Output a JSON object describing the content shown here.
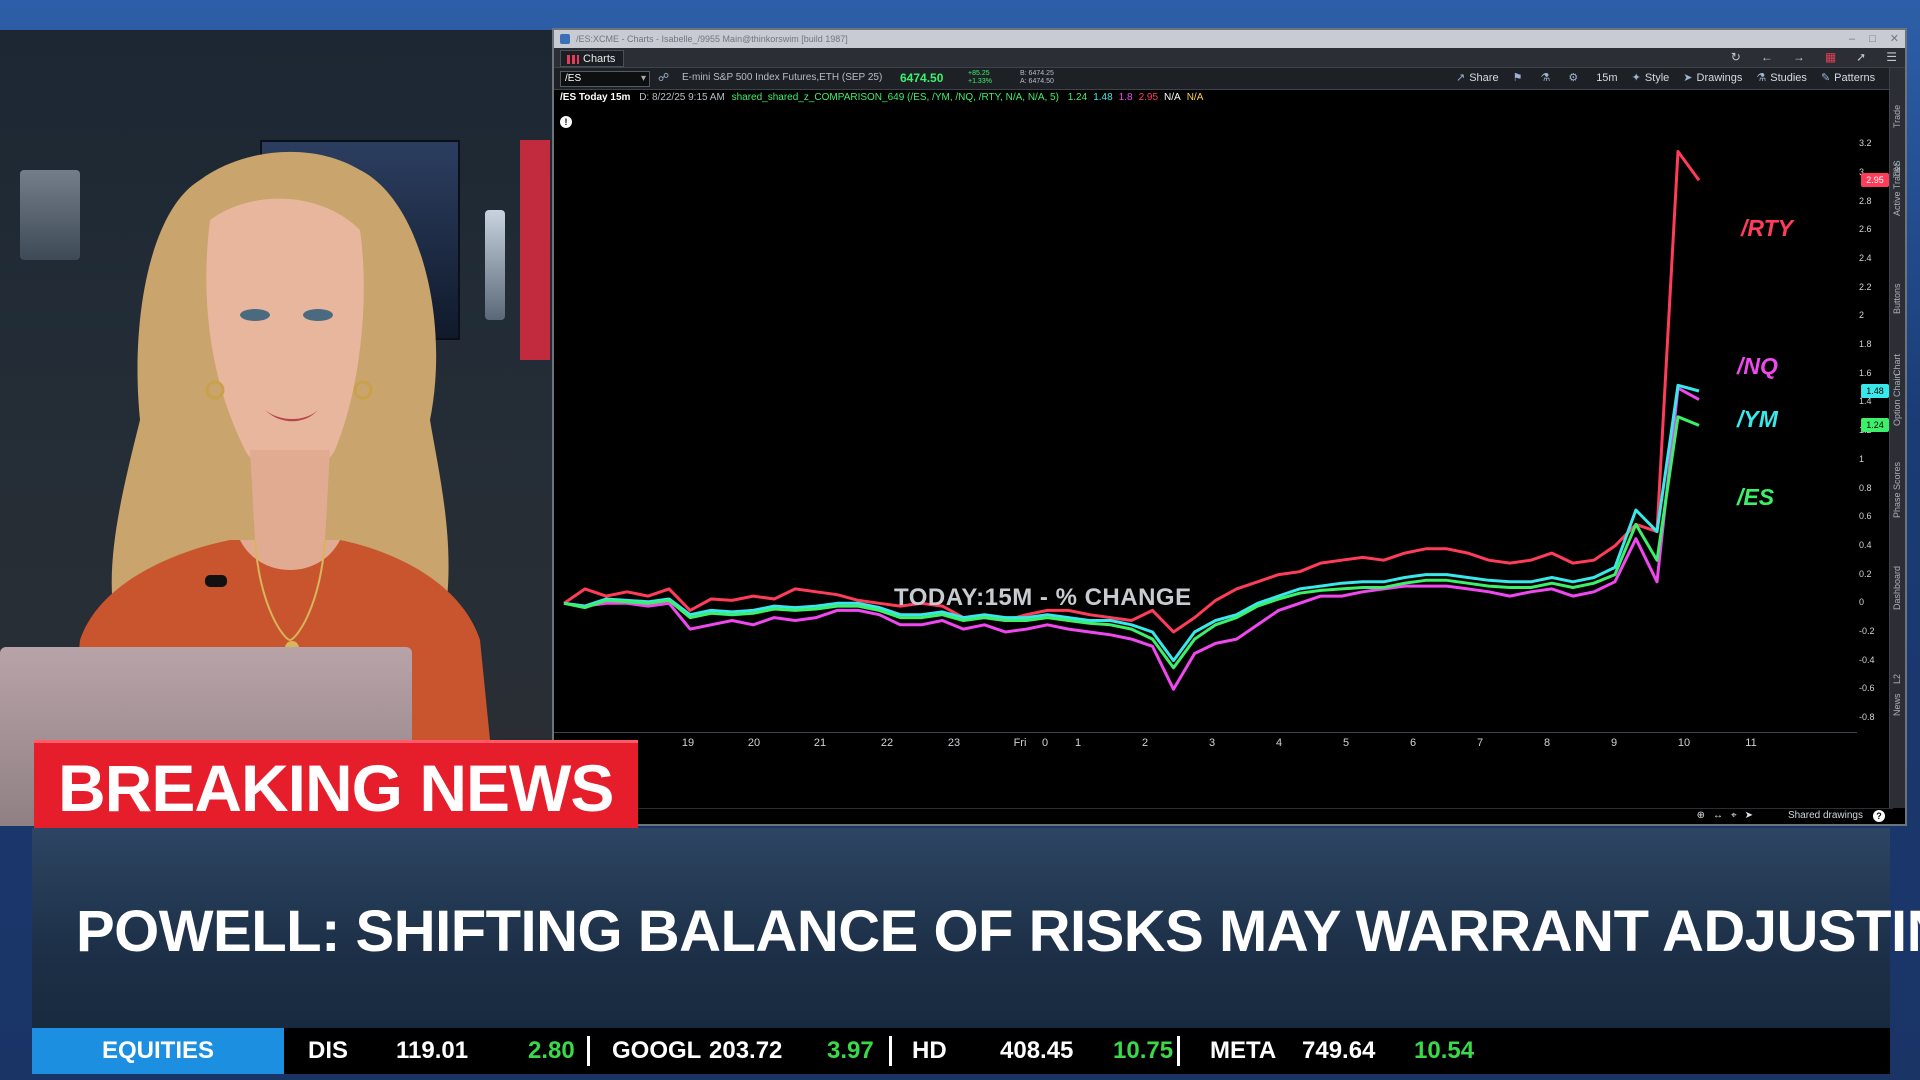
{
  "window": {
    "title": "/ES:XCME - Charts - Isabelle_/9955 Main@thinkorswim [build 1987]",
    "tab_label": "Charts"
  },
  "toolbar": {
    "symbol": "/ES",
    "description": "E-mini S&P 500 Index Futures,ETH (SEP 25)",
    "last_price": "6474.50",
    "net_change": "+85.25",
    "pct_change": "+1.33%",
    "bid": "B: 6474.25",
    "ask": "A: 6474.50",
    "buttons": [
      "Share",
      "15m",
      "Style",
      "Drawings",
      "Studies",
      "Patterns"
    ]
  },
  "study_bar": {
    "symbol_tf": "/ES Today 15m",
    "timestamp": "D: 8/22/25 9:15 AM",
    "study": "shared_shared_z_COMPARISON_649 (/ES, /YM, /NQ, /RTY, N/A, N/A, 5)",
    "values": [
      {
        "text": "1.24",
        "color": "#3df06a"
      },
      {
        "text": "1.48",
        "color": "#38e8ea"
      },
      {
        "text": "1.8",
        "color": "#ee48ee"
      },
      {
        "text": "2.95",
        "color": "#ff3c5a"
      },
      {
        "text": "N/A",
        "color": "#ffffff"
      },
      {
        "text": "N/A",
        "color": "#ffd23c"
      }
    ]
  },
  "side_tabs": [
    "Trade",
    "T&S",
    "Active Trader",
    "Buttons",
    "Chart",
    "Option Chain",
    "Phase Scores",
    "Dashboard",
    "L2",
    "News"
  ],
  "bottom_bar": {
    "shared_drawings": "Shared drawings"
  },
  "chart_data": {
    "type": "line",
    "caption": "TODAY:15M - % CHANGE",
    "x_tick_labels": [
      "19",
      "20",
      "21",
      "22",
      "23",
      "Fri",
      "0",
      "1",
      "2",
      "3",
      "4",
      "5",
      "6",
      "7",
      "8",
      "9",
      "10",
      "11"
    ],
    "y_tick_labels": [
      "3.2",
      "3",
      "2.8",
      "2.6",
      "2.4",
      "2.2",
      "2",
      "1.8",
      "1.6",
      "1.4",
      "1.2",
      "1",
      "0.8",
      "0.6",
      "0.4",
      "0.2",
      "0",
      "-0.2",
      "-0.4",
      "-0.6",
      "-0.8"
    ],
    "ylim": [
      -0.8,
      3.3
    ],
    "series": [
      {
        "name": "/RTY",
        "color": "#ff3c5a",
        "badge": "2.95",
        "values": [
          0,
          0.1,
          0.05,
          0.08,
          0.05,
          0.1,
          -0.05,
          0.03,
          0.02,
          0.05,
          0.03,
          0.1,
          0.08,
          0.06,
          0.02,
          0,
          -0.02,
          0,
          -0.02,
          -0.1,
          -0.1,
          -0.12,
          -0.08,
          -0.05,
          -0.05,
          -0.08,
          -0.1,
          -0.12,
          -0.05,
          -0.2,
          -0.1,
          0.02,
          0.1,
          0.15,
          0.2,
          0.22,
          0.28,
          0.3,
          0.32,
          0.3,
          0.35,
          0.38,
          0.38,
          0.35,
          0.3,
          0.28,
          0.3,
          0.35,
          0.28,
          0.3,
          0.4,
          0.55,
          0.5,
          3.15,
          2.95
        ]
      },
      {
        "name": "/NQ",
        "color": "#ee48ee",
        "badge": "1.8",
        "values": [
          0,
          -0.02,
          0,
          0,
          -0.02,
          0,
          -0.18,
          -0.15,
          -0.12,
          -0.15,
          -0.1,
          -0.12,
          -0.1,
          -0.05,
          -0.05,
          -0.08,
          -0.15,
          -0.15,
          -0.12,
          -0.18,
          -0.15,
          -0.2,
          -0.18,
          -0.15,
          -0.18,
          -0.2,
          -0.22,
          -0.25,
          -0.3,
          -0.6,
          -0.35,
          -0.28,
          -0.25,
          -0.15,
          -0.05,
          0,
          0.05,
          0.05,
          0.08,
          0.1,
          0.12,
          0.12,
          0.12,
          0.1,
          0.08,
          0.05,
          0.08,
          0.1,
          0.05,
          0.08,
          0.15,
          0.45,
          0.15,
          1.5,
          1.42
        ]
      },
      {
        "name": "/YM",
        "color": "#38e8ea",
        "badge": "1.48",
        "values": [
          0,
          -0.02,
          0.03,
          0.02,
          0.01,
          0.03,
          -0.08,
          -0.05,
          -0.06,
          -0.05,
          -0.02,
          -0.03,
          -0.02,
          0,
          0,
          -0.03,
          -0.08,
          -0.08,
          -0.06,
          -0.1,
          -0.08,
          -0.1,
          -0.1,
          -0.08,
          -0.1,
          -0.12,
          -0.12,
          -0.15,
          -0.2,
          -0.4,
          -0.2,
          -0.12,
          -0.08,
          0,
          0.05,
          0.1,
          0.12,
          0.14,
          0.15,
          0.15,
          0.18,
          0.2,
          0.2,
          0.18,
          0.16,
          0.15,
          0.15,
          0.18,
          0.15,
          0.18,
          0.25,
          0.65,
          0.5,
          1.52,
          1.48
        ]
      },
      {
        "name": "/ES",
        "color": "#3df06a",
        "badge": "1.24",
        "values": [
          0,
          -0.03,
          0.02,
          0.01,
          0,
          0.02,
          -0.1,
          -0.07,
          -0.08,
          -0.07,
          -0.04,
          -0.05,
          -0.04,
          -0.02,
          -0.02,
          -0.05,
          -0.1,
          -0.1,
          -0.08,
          -0.12,
          -0.1,
          -0.12,
          -0.12,
          -0.1,
          -0.12,
          -0.14,
          -0.15,
          -0.18,
          -0.25,
          -0.45,
          -0.25,
          -0.15,
          -0.1,
          -0.02,
          0.03,
          0.07,
          0.09,
          0.1,
          0.11,
          0.11,
          0.14,
          0.16,
          0.16,
          0.14,
          0.12,
          0.11,
          0.11,
          0.14,
          0.11,
          0.14,
          0.2,
          0.55,
          0.3,
          1.3,
          1.24
        ]
      }
    ]
  },
  "lower_third": {
    "breaking_label": "BREAKING NEWS",
    "headline": "POWELL: SHIFTING BALANCE OF RISKS MAY WARRANT ADJUSTING POLICY"
  },
  "ticker": {
    "category": "EQUITIES",
    "quotes": [
      {
        "symbol": "DIS",
        "price": "119.01",
        "change": "2.80"
      },
      {
        "symbol": "GOOGL",
        "price": "203.72",
        "change": "3.97"
      },
      {
        "symbol": "HD",
        "price": "408.45",
        "change": "10.75"
      },
      {
        "symbol": "META",
        "price": "749.64",
        "change": "10.54"
      }
    ]
  }
}
